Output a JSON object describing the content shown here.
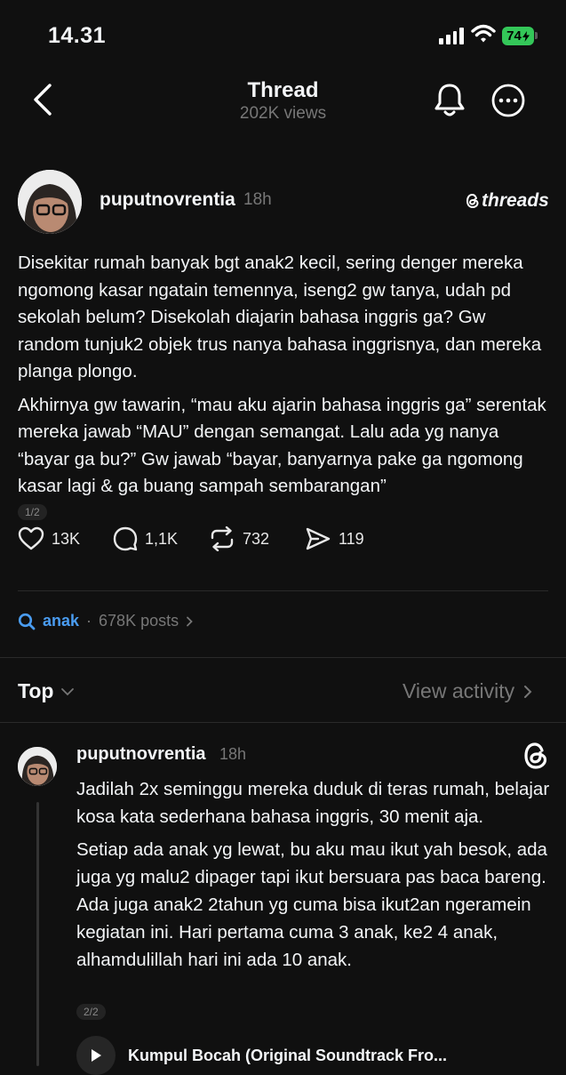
{
  "status_bar": {
    "time": "14.31",
    "battery": "74"
  },
  "header": {
    "title": "Thread",
    "views": "202K views"
  },
  "post": {
    "username": "puputnovrentia",
    "time": "18h",
    "brand": "threads",
    "paragraphs": [
      "Disekitar rumah banyak bgt anak2 kecil, sering denger mereka ngomong kasar ngatain temennya, iseng2 gw tanya, udah pd sekolah belum? Disekolah diajarin bahasa inggris ga? Gw random tunjuk2 objek trus nanya bahasa inggrisnya, dan mereka planga plongo.",
      "Akhirnya gw tawarin, “mau aku ajarin bahasa inggris ga” serentak mereka jawab “MAU” dengan semangat. Lalu ada yg nanya “bayar ga bu?” Gw jawab “bayar, banyarnya pake ga ngomong kasar lagi & ga buang sampah sembarangan”"
    ],
    "page": "1/2",
    "likes": "13K",
    "replies": "1,1K",
    "reposts": "732",
    "shares": "119"
  },
  "topic": {
    "name": "anak",
    "separator": "·",
    "count": "678K posts"
  },
  "sort": {
    "label": "Top",
    "view_activity": "View activity"
  },
  "reply": {
    "username": "puputnovrentia",
    "time": "18h",
    "paragraphs": [
      "Jadilah 2x seminggu mereka duduk di teras rumah, belajar kosa kata sederhana bahasa inggris, 30 menit aja.",
      "Setiap ada anak yg lewat, bu aku mau ikut yah besok, ada juga yg malu2 dipager tapi ikut bersuara pas baca bareng. Ada juga anak2 2tahun yg cuma bisa ikut2an ngeramein kegiatan ini. Hari pertama cuma 3 anak, ke2 4 anak, alhamdulillah hari ini ada 10 anak."
    ],
    "page": "2/2",
    "sound_title": "Kumpul Bocah (Original Soundtrack Fro..."
  },
  "colors": {
    "background": "#101010",
    "accent": "#4a9cf0",
    "muted": "#777777",
    "battery": "#34c759"
  }
}
